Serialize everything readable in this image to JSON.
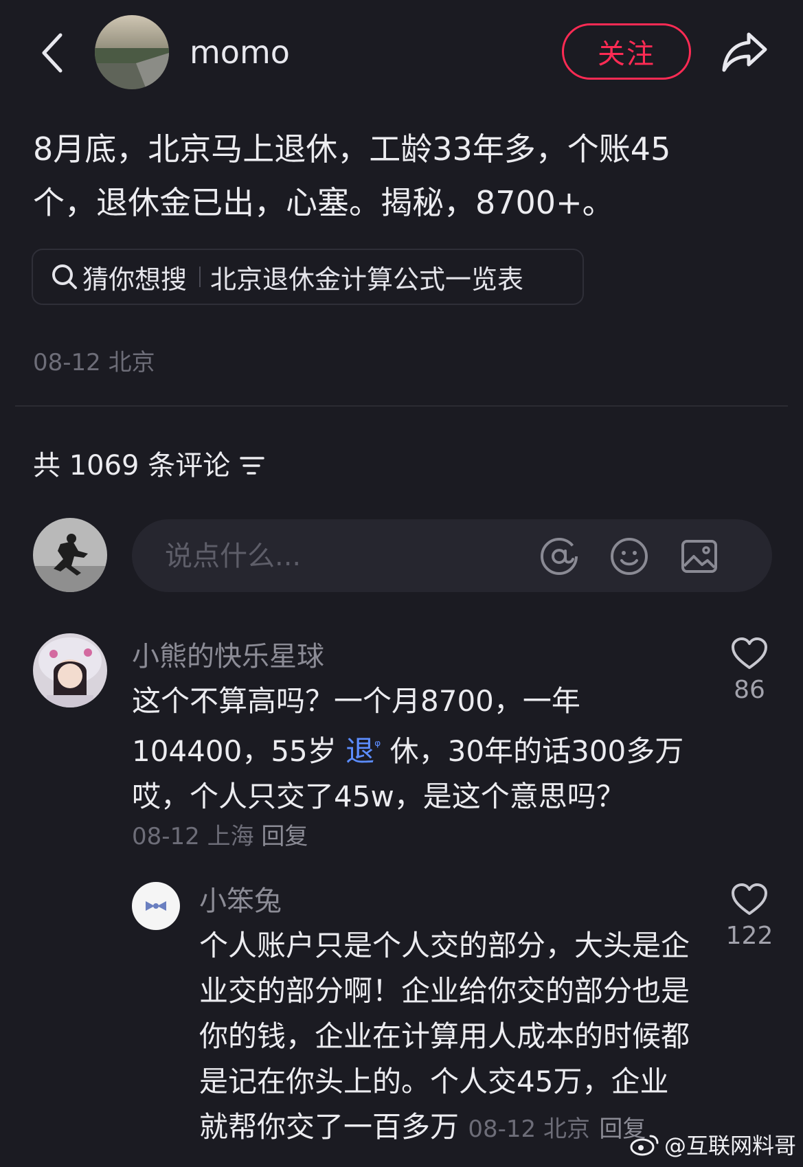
{
  "header": {
    "author_name": "momo",
    "follow_label": "关注"
  },
  "post": {
    "text_line1": "8月底，北京马上退休，工龄33年多，个账45",
    "text_line2": "个，退休金已出，心塞。揭秘，8700+。",
    "search_prefix": "猜你想搜",
    "search_query": "北京退休金计算公式一览表",
    "meta": "08-12 北京"
  },
  "comments_header": {
    "title": "共 1069 条评论"
  },
  "comment_input": {
    "placeholder": "说点什么..."
  },
  "comments": [
    {
      "name": "小熊的快乐星球",
      "line1": "这个不算高吗？一个月8700，一年",
      "line2_pre": "104400，55岁 ",
      "line2_kw": "退",
      "line2_post": " 休，30年的话300多万",
      "line3": "哎，个人只交了45w，是这个意思吗？",
      "date_loc": "08-12 上海",
      "reply_label": "回复",
      "likes": "86"
    },
    {
      "name": "小笨兔",
      "line1": "个人账户只是个人交的部分，大头是企",
      "line2": "业交的部分啊！企业给你交的部分也是",
      "line3": "你的钱，企业在计算用人成本的时候都",
      "line4": "是记在你头上的。个人交45万，企业",
      "line5": "就帮你交了一百多万",
      "date_loc": "08-12 北京",
      "reply_label": "回复",
      "likes": "122"
    }
  ],
  "watermark": {
    "text": "@互联网料哥"
  },
  "colors": {
    "background": "#1b1b22",
    "accent": "#ff2b54",
    "link": "#5c8dff"
  }
}
